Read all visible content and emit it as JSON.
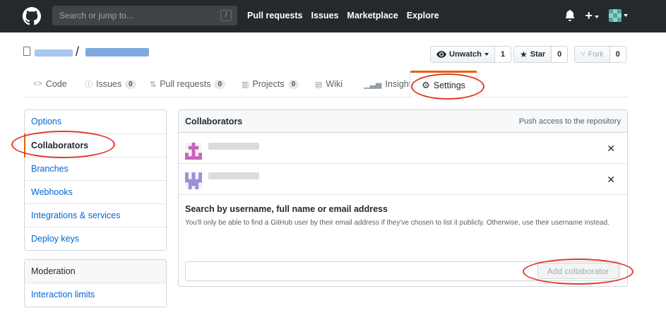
{
  "header": {
    "search_placeholder": "Search or jump to...",
    "search_key": "/",
    "nav": [
      "Pull requests",
      "Issues",
      "Marketplace",
      "Explore"
    ]
  },
  "repo": {
    "separator": "/"
  },
  "actions": {
    "watch_label": "Unwatch",
    "watch_count": "1",
    "star_label": "Star",
    "star_count": "0",
    "fork_label": "Fork",
    "fork_count": "0"
  },
  "tabs": {
    "code": "Code",
    "issues": "Issues",
    "issues_count": "0",
    "pulls": "Pull requests",
    "pulls_count": "0",
    "projects": "Projects",
    "projects_count": "0",
    "wiki": "Wiki",
    "insights": "Insights",
    "settings": "Settings"
  },
  "sidebar": {
    "items": [
      "Options",
      "Collaborators",
      "Branches",
      "Webhooks",
      "Integrations & services",
      "Deploy keys"
    ],
    "moderation_heading": "Moderation",
    "moderation_items": [
      "Interaction limits"
    ]
  },
  "collaborators": {
    "title": "Collaborators",
    "note": "Push access to the repository",
    "remove_symbol": "✕",
    "search_label": "Search by username, full name or email address",
    "search_help": "You'll only be able to find a GitHub user by their email address if they've chosen to list it publicly. Otherwise, use their username instead.",
    "add_button": "Add collaborator"
  },
  "colors": {
    "accent": "#e36209",
    "link": "#0366d6",
    "annotation": "#e03a2e"
  }
}
